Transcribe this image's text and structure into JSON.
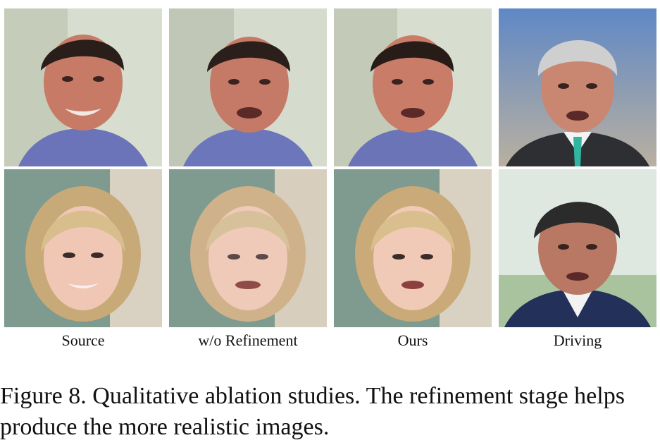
{
  "figure": {
    "columns": [
      "Source",
      "w/o Refinement",
      "Ours",
      "Driving"
    ],
    "caption_line1": "Figure 8. Qualitative ablation studies. The refinement stage helps",
    "caption_line2": "produce the more realistic images."
  },
  "colors": {
    "male_bg": "#c9cfbf",
    "female_bg": "#7f9b8f",
    "news_bg": "#6f96c8"
  }
}
